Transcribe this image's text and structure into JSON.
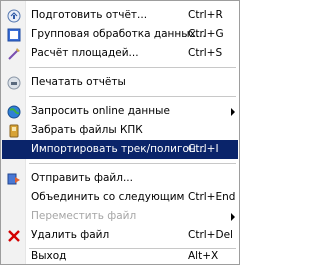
{
  "menu": {
    "items": [
      {
        "label": "Подготовить отчёт...",
        "shortcut": "Ctrl+R",
        "icon": "report-icon"
      },
      {
        "label": "Групповая обработка данных...",
        "shortcut": "Ctrl+G",
        "icon": "batch-processing-icon"
      },
      {
        "label": "Расчёт площадей...",
        "shortcut": "Ctrl+S",
        "icon": "area-calc-icon"
      },
      {
        "label": "Печатать отчёты",
        "shortcut": "",
        "icon": "print-icon"
      },
      {
        "label": "Запросить online данные",
        "shortcut": "",
        "icon": "globe-icon",
        "submenu": true
      },
      {
        "label": "Забрать файлы КПК",
        "shortcut": "",
        "icon": "pda-icon"
      },
      {
        "label": "Импортировать трек/полигон...",
        "shortcut": "Ctrl+I",
        "highlight": true
      },
      {
        "label": "Отправить файл...",
        "shortcut": "",
        "icon": "send-icon"
      },
      {
        "label": "Объединить со следующим",
        "shortcut": "Ctrl+End"
      },
      {
        "label": "Переместить файл",
        "shortcut": "",
        "disabled": true,
        "submenu": true
      },
      {
        "label": "Удалить файл",
        "shortcut": "Ctrl+Del",
        "icon": "delete-icon"
      },
      {
        "label": "Выход",
        "shortcut": "Alt+X"
      }
    ]
  },
  "colors": {
    "highlight_bg": "#0a246a",
    "highlight_text": "#ffffff",
    "disabled_text": "#a6a6a6",
    "delete_icon": "#d40000"
  }
}
